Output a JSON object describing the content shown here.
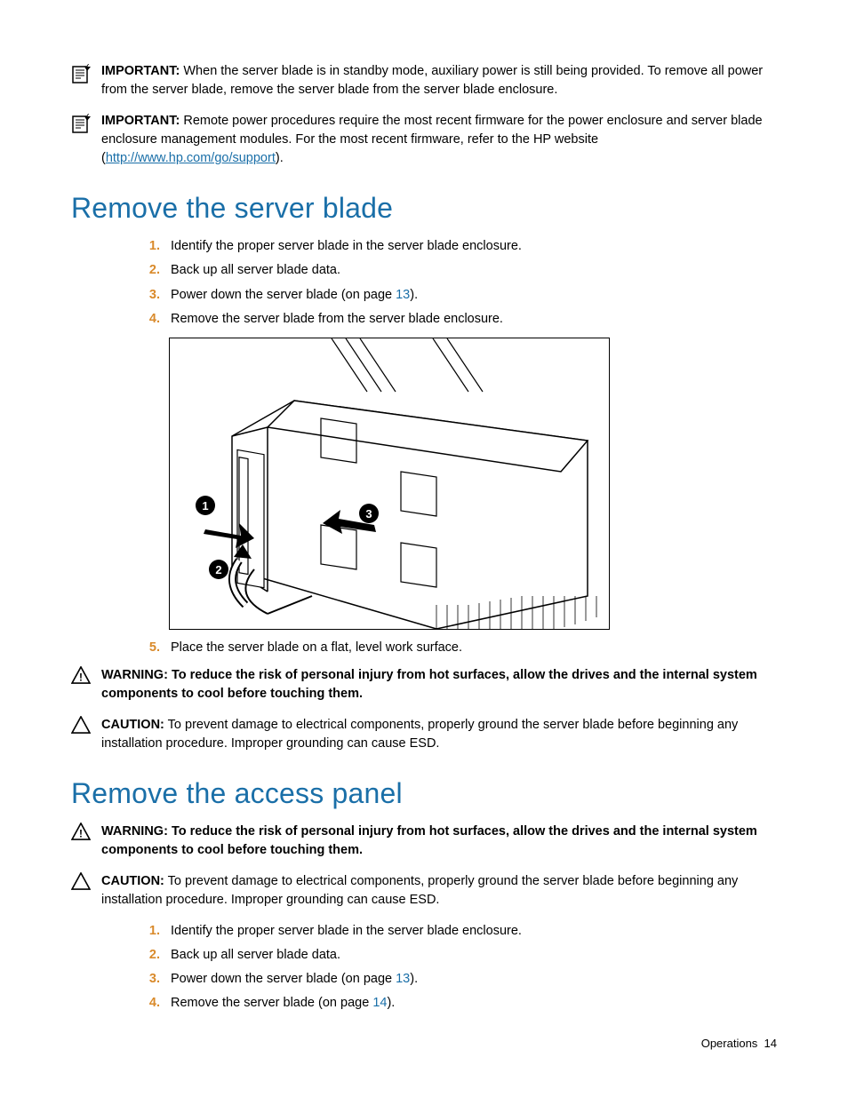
{
  "important1": {
    "label": "IMPORTANT:",
    "text": "When the server blade is in standby mode, auxiliary power is still being provided. To remove all power from the server blade, remove the server blade from the server blade enclosure."
  },
  "important2": {
    "label": "IMPORTANT:",
    "text1": "Remote power procedures require the most recent firmware for the power enclosure and server blade enclosure management modules. For the most recent firmware, refer to the HP website (",
    "link": "http://www.hp.com/go/support",
    "text2": ")."
  },
  "section1": {
    "heading": "Remove the server blade",
    "steps": {
      "s1": "Identify the proper server blade in the server blade enclosure.",
      "s2": "Back up all server blade data.",
      "s3a": "Power down the server blade (on page ",
      "s3p": "13",
      "s3b": ").",
      "s4": "Remove the server blade from the server blade enclosure.",
      "s5": "Place the server blade on a flat, level work surface."
    },
    "warning": {
      "label": "WARNING:",
      "text": "To reduce the risk of personal injury from hot surfaces, allow the drives and the internal system components to cool before touching them."
    },
    "caution": {
      "label": "CAUTION:",
      "text": "To prevent damage to electrical components, properly ground the server blade before beginning any installation procedure. Improper grounding can cause ESD."
    }
  },
  "section2": {
    "heading": "Remove the access panel",
    "warning": {
      "label": "WARNING:",
      "text": "To reduce the risk of personal injury from hot surfaces, allow the drives and the internal system components to cool before touching them."
    },
    "caution": {
      "label": "CAUTION:",
      "text": "To prevent damage to electrical components, properly ground the server blade before beginning any installation procedure. Improper grounding can cause ESD."
    },
    "steps": {
      "s1": "Identify the proper server blade in the server blade enclosure.",
      "s2": "Back up all server blade data.",
      "s3a": "Power down the server blade (on page ",
      "s3p": "13",
      "s3b": ").",
      "s4a": "Remove the server blade (on page ",
      "s4p": "14",
      "s4b": ")."
    }
  },
  "footer": {
    "section": "Operations",
    "page": "14"
  }
}
